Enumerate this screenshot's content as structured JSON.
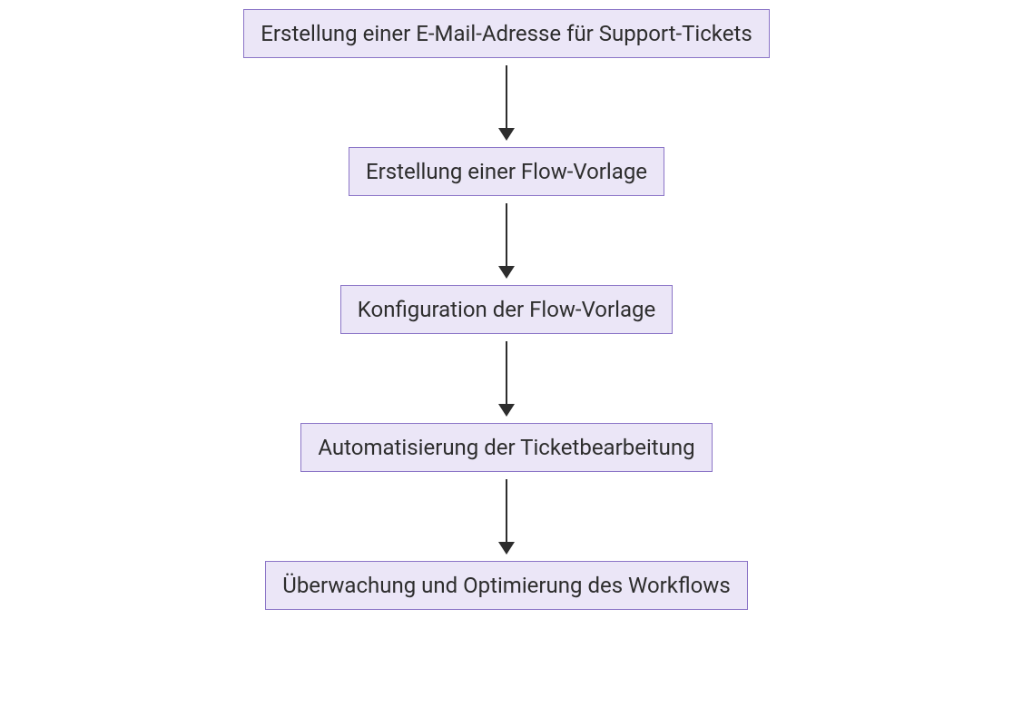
{
  "diagram": {
    "type": "flowchart",
    "direction": "top-to-bottom",
    "nodes": [
      {
        "id": "step1",
        "label": "Erstellung einer E-Mail-Adresse für Support-Tickets"
      },
      {
        "id": "step2",
        "label": "Erstellung einer Flow-Vorlage"
      },
      {
        "id": "step3",
        "label": "Konfiguration der Flow-Vorlage"
      },
      {
        "id": "step4",
        "label": "Automatisierung der Ticketbearbeitung"
      },
      {
        "id": "step5",
        "label": "Überwachung und Optimierung des Workflows"
      }
    ],
    "edges": [
      {
        "from": "step1",
        "to": "step2"
      },
      {
        "from": "step2",
        "to": "step3"
      },
      {
        "from": "step3",
        "to": "step4"
      },
      {
        "from": "step4",
        "to": "step5"
      }
    ],
    "style": {
      "node_fill": "#ebe6f7",
      "node_border": "#8b75c7",
      "text_color": "#2d2d2d",
      "arrow_color": "#2d2d2d"
    }
  }
}
